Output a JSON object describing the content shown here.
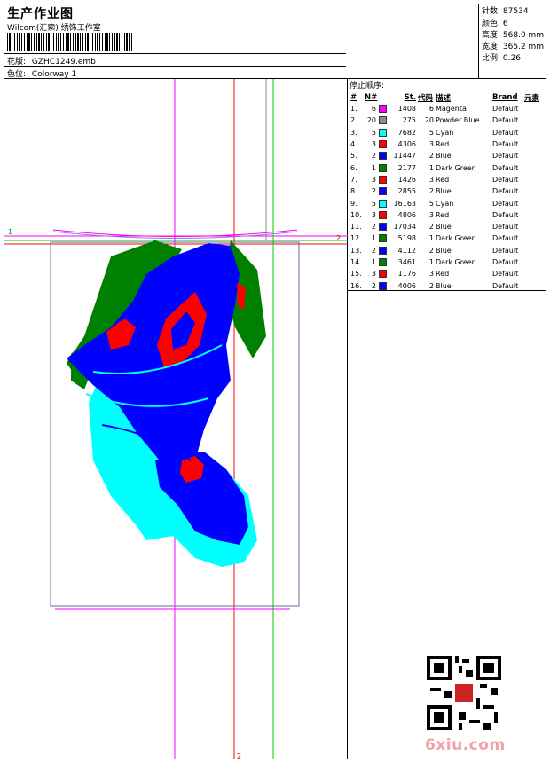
{
  "header": {
    "title": "生产作业图",
    "subtitle": "Wilcom(汇索) 绣饰工作室",
    "design_label": "花版:",
    "design_value": "GZHC1249.emb",
    "colorway_label": "色位:",
    "colorway_value": "Colorway 1"
  },
  "stats": [
    {
      "label": "针数:",
      "value": "87534"
    },
    {
      "label": "颜色:",
      "value": "6"
    },
    {
      "label": "高度:",
      "value": "568.0 mm"
    },
    {
      "label": "宽度:",
      "value": "365.2 mm"
    },
    {
      "label": "比例:",
      "value": "0.26"
    }
  ],
  "stop_sequence": {
    "heading": "停止顺序:",
    "columns": [
      "#",
      "N#",
      "St.",
      "代码",
      "描述",
      "Brand",
      "元素"
    ],
    "rows": [
      {
        "idx": "1.",
        "n": "6",
        "color": "#ff00ff",
        "st": "1408",
        "code": "6",
        "desc": "Magenta",
        "brand": "Default"
      },
      {
        "idx": "2.",
        "n": "20",
        "color": "#8c8ca0",
        "st": "275",
        "code": "20",
        "desc": "Powder Blue",
        "brand": "Default"
      },
      {
        "idx": "3.",
        "n": "5",
        "color": "#00ffff",
        "st": "7682",
        "code": "5",
        "desc": "Cyan",
        "brand": "Default"
      },
      {
        "idx": "4.",
        "n": "3",
        "color": "#ff0000",
        "st": "4306",
        "code": "3",
        "desc": "Red",
        "brand": "Default"
      },
      {
        "idx": "5.",
        "n": "2",
        "color": "#0000ff",
        "st": "11447",
        "code": "2",
        "desc": "Blue",
        "brand": "Default"
      },
      {
        "idx": "6.",
        "n": "1",
        "color": "#008000",
        "st": "2177",
        "code": "1",
        "desc": "Dark Green",
        "brand": "Default"
      },
      {
        "idx": "7.",
        "n": "3",
        "color": "#ff0000",
        "st": "1426",
        "code": "3",
        "desc": "Red",
        "brand": "Default"
      },
      {
        "idx": "8.",
        "n": "2",
        "color": "#0000ff",
        "st": "2855",
        "code": "2",
        "desc": "Blue",
        "brand": "Default"
      },
      {
        "idx": "9.",
        "n": "5",
        "color": "#00ffff",
        "st": "16163",
        "code": "5",
        "desc": "Cyan",
        "brand": "Default"
      },
      {
        "idx": "10.",
        "n": "3",
        "color": "#ff0000",
        "st": "4806",
        "code": "3",
        "desc": "Red",
        "brand": "Default"
      },
      {
        "idx": "11.",
        "n": "2",
        "color": "#0000ff",
        "st": "17034",
        "code": "2",
        "desc": "Blue",
        "brand": "Default"
      },
      {
        "idx": "12.",
        "n": "1",
        "color": "#008000",
        "st": "5198",
        "code": "1",
        "desc": "Dark Green",
        "brand": "Default"
      },
      {
        "idx": "13.",
        "n": "2",
        "color": "#0000ff",
        "st": "4112",
        "code": "2",
        "desc": "Blue",
        "brand": "Default"
      },
      {
        "idx": "14.",
        "n": "1",
        "color": "#008000",
        "st": "3461",
        "code": "1",
        "desc": "Dark Green",
        "brand": "Default"
      },
      {
        "idx": "15.",
        "n": "3",
        "color": "#ff0000",
        "st": "1176",
        "code": "3",
        "desc": "Red",
        "brand": "Default"
      },
      {
        "idx": "16.",
        "n": "2",
        "color": "#0000ff",
        "st": "4006",
        "code": "2",
        "desc": "Blue",
        "brand": "Default"
      }
    ]
  },
  "design_markers": {
    "top_right": ":",
    "left_1": "1",
    "right_2": "2",
    "bottom_2": "2"
  },
  "watermark": "6xiu.com"
}
